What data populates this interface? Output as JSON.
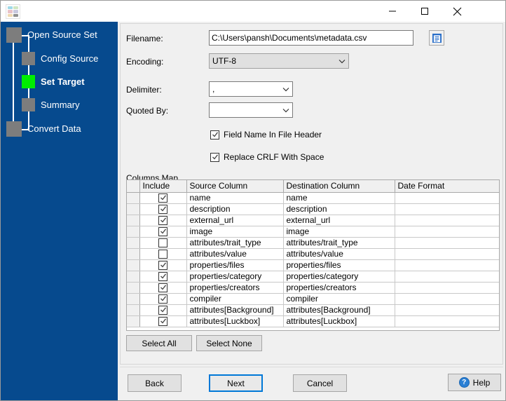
{
  "window": {
    "app_icon": "grid-app-icon",
    "minimize": "minimize-icon",
    "maximize": "maximize-icon",
    "close": "close-icon"
  },
  "sidebar": {
    "steps": [
      {
        "label": "Open Source Set",
        "state": "done"
      },
      {
        "label": "Config Source",
        "state": "done"
      },
      {
        "label": "Set Target",
        "state": "active"
      },
      {
        "label": "Summary",
        "state": "pending"
      },
      {
        "label": "Convert Data",
        "state": "pending"
      }
    ],
    "active_color": "#00ee00",
    "box_color": "#7d7d7d",
    "background": "#064a8e"
  },
  "form": {
    "filename_label": "Filename:",
    "filename_value": "C:\\Users\\pansh\\Documents\\metadata.csv",
    "browse_icon": "file-browse-icon",
    "encoding_label": "Encoding:",
    "encoding_value": "UTF-8",
    "delimiter_label": "Delimiter:",
    "delimiter_value": ",",
    "quoted_by_label": "Quoted By:",
    "quoted_by_value": "",
    "field_name_header_label": "Field Name In File Header",
    "field_name_header_checked": true,
    "replace_crlf_label": "Replace CRLF With Space",
    "replace_crlf_checked": true
  },
  "columns_map": {
    "title": "Columns Map",
    "headers": [
      "",
      "Include",
      "Source Column",
      "Destination Column",
      "Date Format"
    ],
    "rows": [
      {
        "include": true,
        "source": "name",
        "destination": "name",
        "date_format": ""
      },
      {
        "include": true,
        "source": "description",
        "destination": "description",
        "date_format": ""
      },
      {
        "include": true,
        "source": "external_url",
        "destination": "external_url",
        "date_format": ""
      },
      {
        "include": true,
        "source": "image",
        "destination": "image",
        "date_format": ""
      },
      {
        "include": false,
        "source": "attributes/trait_type",
        "destination": "attributes/trait_type",
        "date_format": ""
      },
      {
        "include": false,
        "source": "attributes/value",
        "destination": "attributes/value",
        "date_format": ""
      },
      {
        "include": true,
        "source": "properties/files",
        "destination": "properties/files",
        "date_format": ""
      },
      {
        "include": true,
        "source": "properties/category",
        "destination": "properties/category",
        "date_format": ""
      },
      {
        "include": true,
        "source": "properties/creators",
        "destination": "properties/creators",
        "date_format": ""
      },
      {
        "include": true,
        "source": "compiler",
        "destination": "compiler",
        "date_format": ""
      },
      {
        "include": true,
        "source": "attributes[Background]",
        "destination": "attributes[Background]",
        "date_format": ""
      },
      {
        "include": true,
        "source": "attributes[Luckbox]",
        "destination": "attributes[Luckbox]",
        "date_format": ""
      }
    ],
    "select_all_label": "Select All",
    "select_none_label": "Select None"
  },
  "footer": {
    "back_label": "Back",
    "next_label": "Next",
    "cancel_label": "Cancel",
    "help_label": "Help",
    "help_icon_glyph": "?",
    "focus_color": "#0078d7"
  }
}
